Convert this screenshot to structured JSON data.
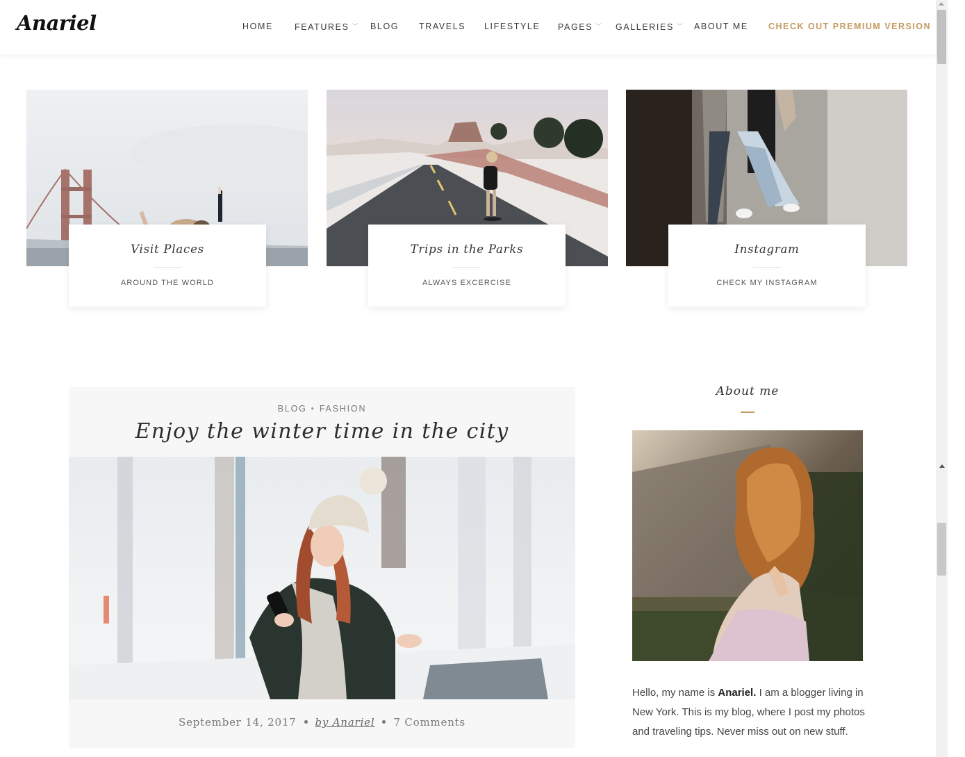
{
  "header": {
    "logo": "Anariel",
    "nav": [
      {
        "label": "HOME",
        "has_dropdown": false
      },
      {
        "label": "FEATURES",
        "has_dropdown": true
      },
      {
        "label": "BLOG",
        "has_dropdown": false
      },
      {
        "label": "TRAVELS",
        "has_dropdown": false
      },
      {
        "label": "LIFESTYLE",
        "has_dropdown": false
      },
      {
        "label": "PAGES",
        "has_dropdown": true
      },
      {
        "label": "GALLERIES",
        "has_dropdown": true
      },
      {
        "label": "ABOUT ME",
        "has_dropdown": false
      }
    ],
    "premium_label": "CHECK OUT PREMIUM VERSION",
    "chevron_glyph": "﹀"
  },
  "features": [
    {
      "title": "Visit Places",
      "subtitle": "AROUND THE WORLD",
      "image": "bridge-friends-photo"
    },
    {
      "title": "Trips in the Parks",
      "subtitle": "ALWAYS EXCERCISE",
      "image": "road-skater-photo"
    },
    {
      "title": "Instagram",
      "subtitle": "CHECK MY INSTAGRAM",
      "image": "wall-girl-photo"
    }
  ],
  "post": {
    "category_1": "BLOG",
    "category_sep": "•",
    "category_2": "FASHION",
    "title": "Enjoy the winter time in the city",
    "image": "winter-girl-photo",
    "date": "September 14, 2017",
    "author": "by Anariel",
    "comments": "7 Comments"
  },
  "sidebar": {
    "about_title": "About me",
    "about_image": "curly-hair-woman-photo",
    "about_text_1": "Hello, my name is ",
    "about_name": "Anariel.",
    "about_text_2": " I am a blogger living in New York. This is my blog, where I post my photos and traveling tips. Never miss out on new stuff."
  },
  "colors": {
    "accent": "#c39a5e",
    "text": "#333333",
    "panel": "#f7f7f7"
  }
}
